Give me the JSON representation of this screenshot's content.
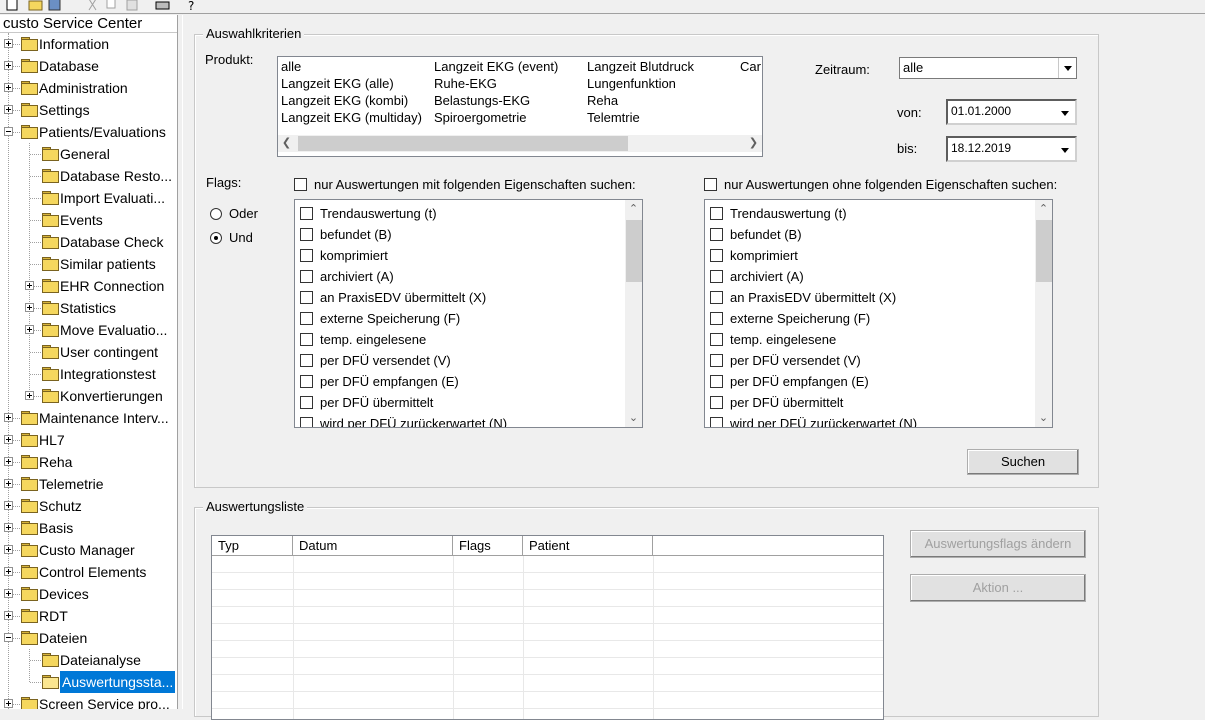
{
  "tree": {
    "root_label": "custo Service Center",
    "items": [
      {
        "label": "Information",
        "level": 0,
        "expander": "plus"
      },
      {
        "label": "Database",
        "level": 0,
        "expander": "plus"
      },
      {
        "label": "Administration",
        "level": 0,
        "expander": "plus"
      },
      {
        "label": "Settings",
        "level": 0,
        "expander": "plus"
      },
      {
        "label": "Patients/Evaluations",
        "level": 0,
        "expander": "minus"
      },
      {
        "label": "General",
        "level": 1,
        "expander": "none"
      },
      {
        "label": "Database Resto...",
        "level": 1,
        "expander": "none"
      },
      {
        "label": "Import Evaluati...",
        "level": 1,
        "expander": "none"
      },
      {
        "label": "Events",
        "level": 1,
        "expander": "none"
      },
      {
        "label": "Database Check",
        "level": 1,
        "expander": "none"
      },
      {
        "label": "Similar patients",
        "level": 1,
        "expander": "none"
      },
      {
        "label": "EHR Connection",
        "level": 1,
        "expander": "plus"
      },
      {
        "label": "Statistics",
        "level": 1,
        "expander": "plus"
      },
      {
        "label": "Move Evaluatio...",
        "level": 1,
        "expander": "plus"
      },
      {
        "label": "User contingent",
        "level": 1,
        "expander": "none"
      },
      {
        "label": "Integrationstest",
        "level": 1,
        "expander": "none"
      },
      {
        "label": "Konvertierungen",
        "level": 1,
        "expander": "plus"
      },
      {
        "label": "Maintenance Interv...",
        "level": 0,
        "expander": "plus"
      },
      {
        "label": "HL7",
        "level": 0,
        "expander": "plus"
      },
      {
        "label": "Reha",
        "level": 0,
        "expander": "plus"
      },
      {
        "label": "Telemetrie",
        "level": 0,
        "expander": "plus"
      },
      {
        "label": "Schutz",
        "level": 0,
        "expander": "plus"
      },
      {
        "label": "Basis",
        "level": 0,
        "expander": "plus"
      },
      {
        "label": "Custo Manager",
        "level": 0,
        "expander": "plus"
      },
      {
        "label": "Control Elements",
        "level": 0,
        "expander": "plus"
      },
      {
        "label": "Devices",
        "level": 0,
        "expander": "plus"
      },
      {
        "label": "RDT",
        "level": 0,
        "expander": "plus"
      },
      {
        "label": "Dateien",
        "level": 0,
        "expander": "minus"
      },
      {
        "label": "Dateianalyse",
        "level": 1,
        "expander": "none"
      },
      {
        "label": "Auswertungssta...",
        "level": 1,
        "expander": "none",
        "selected": true
      },
      {
        "label": "Screen Service pro...",
        "level": 0,
        "expander": "plus"
      }
    ]
  },
  "criteria": {
    "group_title": "Auswahlkriterien",
    "produkt_label": "Produkt:",
    "products": [
      [
        "alle",
        "Langzeit EKG (alle)",
        "Langzeit EKG (kombi)",
        "Langzeit EKG (multiday)"
      ],
      [
        "Langzeit EKG (event)",
        "Ruhe-EKG",
        "Belastungs-EKG",
        "Spiroergometrie"
      ],
      [
        "Langzeit Blutdruck",
        "Lungenfunktion",
        "Reha",
        "Telemtrie"
      ],
      [
        "Car"
      ]
    ],
    "zeitraum_label": "Zeitraum:",
    "zeitraum_value": "alle",
    "von_label": "von:",
    "von_value": "01.01.2000",
    "bis_label": "bis:",
    "bis_value": "18.12.2019",
    "flags_label": "Flags:",
    "oder_label": "Oder",
    "und_label": "Und",
    "selected_logic": "Und",
    "with_label": "nur Auswertungen mit folgenden Eigenschaften suchen:",
    "without_label": "nur Auswertungen ohne folgenden Eigenschaften suchen:",
    "flags": [
      "Trendauswertung (t)",
      "befundet (B)",
      "komprimiert",
      "archiviert (A)",
      "an PraxisEDV übermittelt (X)",
      "externe Speicherung (F)",
      "temp. eingelesene",
      "per DFÜ versendet (V)",
      "per DFÜ empfangen (E)",
      "per DFÜ übermittelt",
      "wird per DFÜ zurückerwartet (N)"
    ],
    "search_button": "Suchen"
  },
  "results": {
    "group_title": "Auswertungsliste",
    "columns": [
      "Typ",
      "Datum",
      "Flags",
      "Patient"
    ],
    "change_flags_button": "Auswertungsflags ändern",
    "action_button": "Aktion ..."
  }
}
